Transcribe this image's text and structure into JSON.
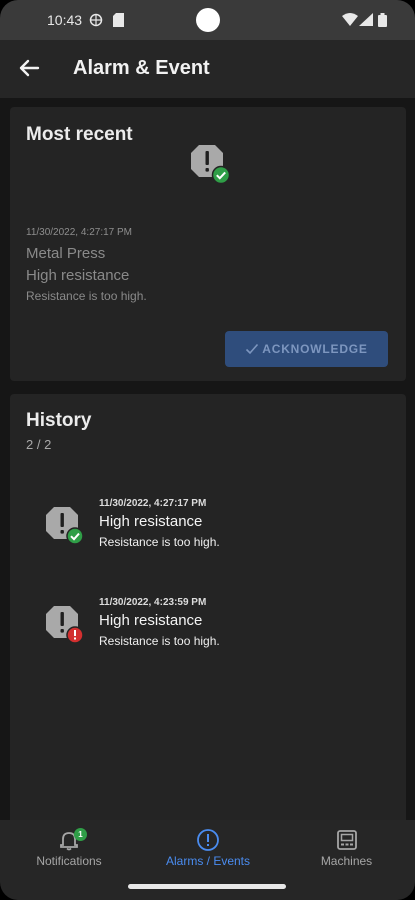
{
  "status_bar": {
    "time": "10:43"
  },
  "app_bar": {
    "title": "Alarm & Event"
  },
  "most_recent": {
    "title": "Most recent",
    "timestamp": "11/30/2022, 4:27:17 PM",
    "machine": "Metal Press",
    "alarm": "High resistance",
    "description": "Resistance is too high.",
    "status": "acknowledged",
    "acknowledge_label": "ACKNOWLEDGE"
  },
  "history": {
    "title": "History",
    "count": "2 / 2",
    "items": [
      {
        "timestamp": "11/30/2022, 4:27:17 PM",
        "name": "High resistance",
        "description": "Resistance is too high.",
        "status": "acknowledged"
      },
      {
        "timestamp": "11/30/2022, 4:23:59 PM",
        "name": "High resistance",
        "description": "Resistance is too high.",
        "status": "unacknowledged"
      }
    ]
  },
  "bottom_nav": {
    "items": [
      {
        "label": "Notifications",
        "icon": "bell-icon",
        "badge": "1"
      },
      {
        "label": "Alarms / Events",
        "icon": "alert-circle-icon"
      },
      {
        "label": "Machines",
        "icon": "machine-icon"
      }
    ],
    "active_index": 1
  },
  "colors": {
    "accent": "#4a8cf0",
    "success": "#2f9e47",
    "error": "#d32f2f",
    "button_bg": "#2f4d7c"
  }
}
